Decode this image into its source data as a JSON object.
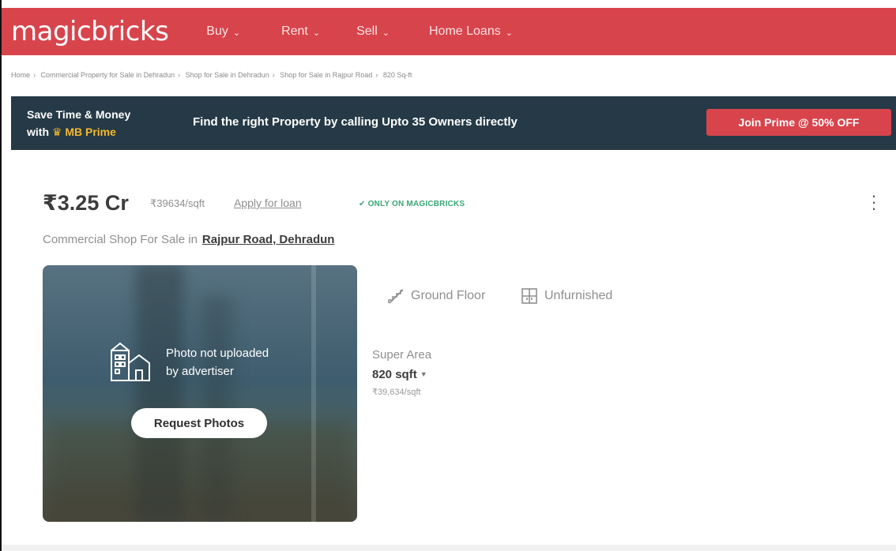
{
  "header": {
    "logo": "magicbricks",
    "nav": [
      {
        "label": "Buy"
      },
      {
        "label": "Rent"
      },
      {
        "label": "Sell"
      },
      {
        "label": "Home Loans"
      }
    ]
  },
  "breadcrumb": [
    "Home",
    "Commercial Property for Sale in Dehradun",
    "Shop for Sale in Dehradun",
    "Shop for Sale in Rajpur Road",
    "820 Sq-ft"
  ],
  "prime_banner": {
    "line1": "Save Time & Money",
    "line2_prefix": "with",
    "brand": "MB Prime",
    "message": "Find the right Property by calling Upto 35 Owners directly",
    "cta": "Join Prime @ 50% OFF"
  },
  "listing": {
    "price": "₹3.25 Cr",
    "price_per_sqft": "₹39634/sqft",
    "loan_link": "Apply for loan",
    "exclusive_badge": "ONLY ON MAGICBRICKS",
    "subtitle": "Commercial Shop For Sale in",
    "location": "Rajpur Road, Dehradun",
    "photo_message_line1": "Photo not uploaded",
    "photo_message_line2": "by advertiser",
    "request_photos": "Request Photos",
    "floor": "Ground Floor",
    "furnishing": "Unfurnished",
    "super_area_label": "Super Area",
    "super_area_value": "820 sqft",
    "super_area_rate": "₹39,634/sqft"
  },
  "colors": {
    "brand_red": "#d8444c",
    "banner_dark": "#253a46",
    "prime_gold": "#f5b82e",
    "badge_green": "#3aa576"
  }
}
